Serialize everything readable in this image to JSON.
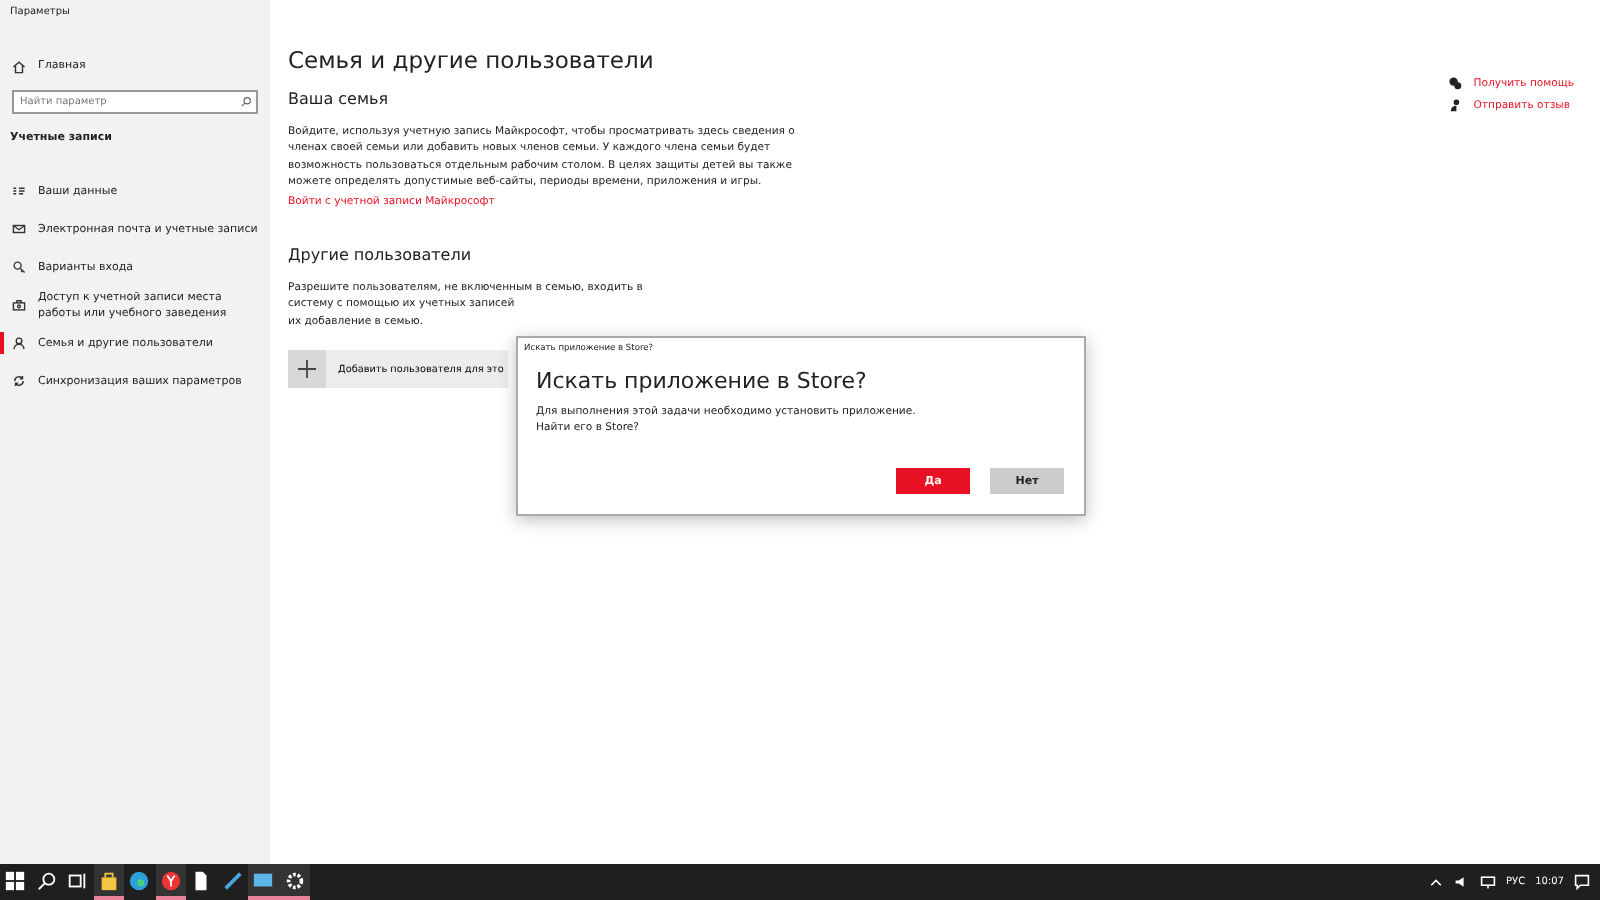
{
  "window": {
    "title": "Параметры"
  },
  "sidebar": {
    "home": "Главная",
    "search": {
      "placeholder": "Найти параметр"
    },
    "section": "Учетные записи",
    "items": [
      {
        "label": "Ваши данные",
        "kind": "card",
        "selected": false
      },
      {
        "label": "Электронная почта и учетные записи",
        "kind": "mail",
        "selected": false
      },
      {
        "label": "Варианты входа",
        "kind": "key",
        "selected": false
      },
      {
        "label": "Доступ к учетной записи места работы или учебного заведения",
        "kind": "briefcase",
        "selected": false
      },
      {
        "label": "Семья и другие пользователи",
        "kind": "person",
        "selected": true
      },
      {
        "label": "Синхронизация ваших параметров",
        "kind": "sync",
        "selected": false
      }
    ]
  },
  "main": {
    "title": "Семья и другие пользователи",
    "family_heading": "Ваша семья",
    "family_text": "Войдите, используя учетную запись Майкрософт, чтобы просматривать здесь сведения о членах своей семьи или добавить новых членов семьи. У каждого члена семьи будет возможность пользоваться отдельным рабочим столом. В целях защиты детей вы также можете определять допустимые веб-сайты, периоды времени, приложения и игры.",
    "family_link": "Войти с учетной записи Майкрософт",
    "others_heading": "Другие пользователи",
    "others_lines": [
      "Разрешите пользователям, не включенным в семью, входить в",
      "систему с помощью их учетных записей",
      "их добавление в семью."
    ],
    "add_button": "Добавить пользователя для это"
  },
  "help_links": [
    {
      "label": "Получить помощь",
      "kind": "help"
    },
    {
      "label": "Отправить отзыв",
      "kind": "feedback"
    }
  ],
  "dialog": {
    "caption": "Искать приложение в Store?",
    "title": "Искать приложение в Store?",
    "lines": [
      "Для выполнения этой задачи необходимо установить приложение.",
      "Найти его в Store?"
    ],
    "buttons": [
      {
        "label": "Да",
        "primary": true
      },
      {
        "label": "Нет",
        "primary": false
      }
    ]
  },
  "taskbar": {
    "apps": [
      {
        "kind": "start",
        "running": false
      },
      {
        "kind": "search",
        "running": false
      },
      {
        "kind": "taskview",
        "running": false
      },
      {
        "kind": "store",
        "running": true
      },
      {
        "kind": "edge",
        "running": false
      },
      {
        "kind": "yandex",
        "running": true
      },
      {
        "kind": "file",
        "running": false
      },
      {
        "kind": "steam",
        "running": false
      },
      {
        "kind": "monitor",
        "running": true
      },
      {
        "kind": "settings",
        "running": true
      }
    ],
    "language": "РУС",
    "time": "10:07"
  }
}
